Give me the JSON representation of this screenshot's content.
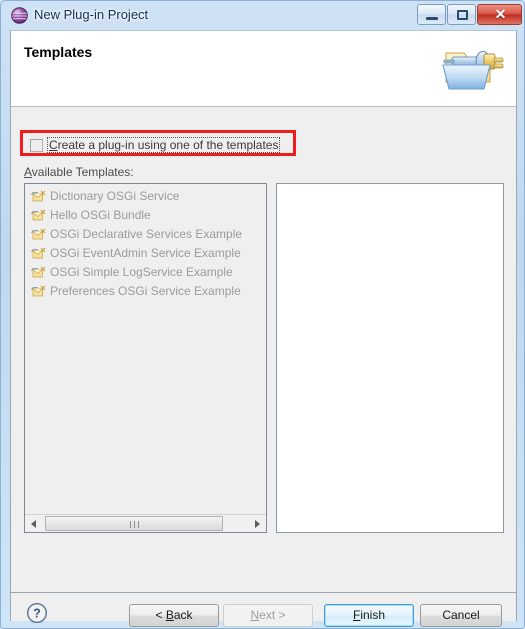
{
  "window": {
    "title": "New Plug-in Project",
    "icon": "eclipse-sphere-icon",
    "controls": {
      "minimize": "minimize-button",
      "restore": "restore-button",
      "close": "close-button",
      "close_glyph": "✕"
    }
  },
  "banner": {
    "title": "Templates",
    "icon": "plugin-folder-icon"
  },
  "checkbox": {
    "label_mnemonic": "C",
    "label_rest": "reate a plug-in using one of the templates",
    "checked": false,
    "highlight_color": "#ee1c1c"
  },
  "list": {
    "label_mnemonic": "A",
    "label_rest": "vailable Templates:",
    "enabled": false,
    "items": [
      {
        "label": "Dictionary OSGi Service",
        "icon": "template-plugin-icon"
      },
      {
        "label": "Hello OSGi Bundle",
        "icon": "template-plugin-icon"
      },
      {
        "label": "OSGi Declarative Services Example",
        "icon": "template-plugin-icon"
      },
      {
        "label": "OSGi EventAdmin Service Example",
        "icon": "template-plugin-icon"
      },
      {
        "label": "OSGi Simple LogService Example",
        "icon": "template-plugin-icon"
      },
      {
        "label": "Preferences OSGi Service Example",
        "icon": "template-plugin-icon"
      }
    ]
  },
  "description_panel": {
    "content": ""
  },
  "buttons": {
    "help": "help-icon",
    "back": {
      "prefix": "< ",
      "mnemonic": "B",
      "rest": "ack",
      "state": "enabled"
    },
    "next": {
      "prefix": "",
      "mnemonic": "N",
      "rest": "ext >",
      "state": "disabled"
    },
    "finish": {
      "prefix": "",
      "mnemonic": "F",
      "rest": "inish",
      "state": "default"
    },
    "cancel": {
      "prefix": "",
      "mnemonic": "",
      "rest": "Cancel",
      "state": "enabled"
    }
  }
}
